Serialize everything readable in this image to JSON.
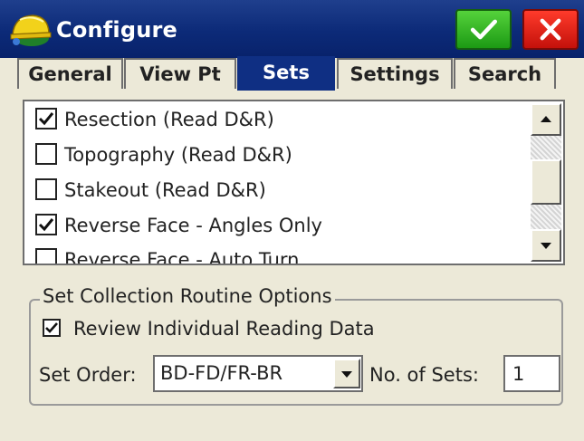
{
  "window": {
    "title": "Configure",
    "app_icon": "surveyor-helmet-icon",
    "ok_icon": "check-icon",
    "close_icon": "close-icon",
    "ok_color": "#2fb31d",
    "close_color": "#e5170f",
    "titlebar_color": "#0f2f83"
  },
  "tabs": [
    {
      "label": "General",
      "active": false
    },
    {
      "label": "View Pt",
      "active": false
    },
    {
      "label": "Sets",
      "active": true
    },
    {
      "label": "Settings",
      "active": false
    },
    {
      "label": "Search",
      "active": false
    }
  ],
  "set_list": {
    "items": [
      {
        "label": "Resection (Read D&R)",
        "checked": true
      },
      {
        "label": "Topography (Read D&R)",
        "checked": false
      },
      {
        "label": "Stakeout (Read D&R)",
        "checked": false
      },
      {
        "label": "Reverse Face - Angles Only",
        "checked": true
      },
      {
        "label": "Reverse Face - Auto Turn",
        "checked": false
      }
    ],
    "scroll_up_icon": "arrow-up-icon",
    "scroll_down_icon": "arrow-down-icon"
  },
  "options": {
    "group_title": "Set Collection Routine Options",
    "review_label": "Review Individual Reading Data",
    "review_checked": true,
    "set_order_label": "Set Order:",
    "set_order_value": "BD-FD/FR-BR",
    "dropdown_icon": "chevron-down-icon",
    "num_sets_label": "No. of Sets:",
    "num_sets_value": "1"
  }
}
